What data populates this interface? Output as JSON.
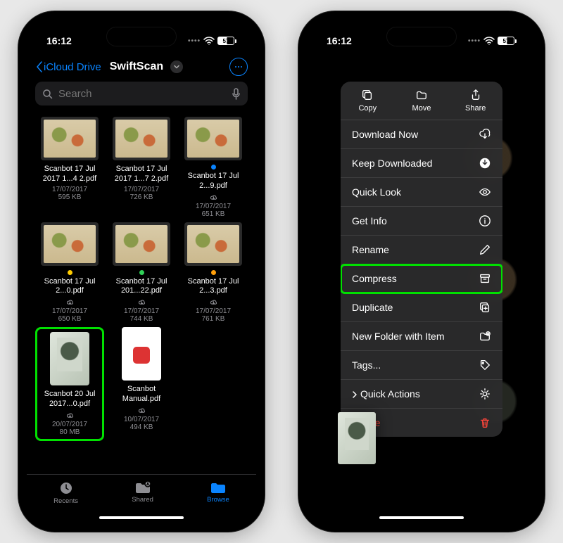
{
  "status": {
    "time": "16:12",
    "battery": "57"
  },
  "nav": {
    "back_label": "iCloud Drive",
    "title": "SwiftScan"
  },
  "search": {
    "placeholder": "Search"
  },
  "files": [
    {
      "name": "Scanbot 17 Jul 2017 1...4 2.pdf",
      "date": "17/07/2017",
      "size": "595 KB",
      "tag": null,
      "cloud": false,
      "thumb": "food"
    },
    {
      "name": "Scanbot 17 Jul 2017 1...7 2.pdf",
      "date": "17/07/2017",
      "size": "726 KB",
      "tag": null,
      "cloud": false,
      "thumb": "food"
    },
    {
      "name": "Scanbot 17 Jul 2...9.pdf",
      "date": "17/07/2017",
      "size": "651 KB",
      "tag": "#0a84ff",
      "cloud": true,
      "thumb": "food"
    },
    {
      "name": "Scanbot 17 Jul 2...0.pdf",
      "date": "17/07/2017",
      "size": "650 KB",
      "tag": "#ffcc00",
      "cloud": true,
      "thumb": "food"
    },
    {
      "name": "Scanbot 17 Jul 201...22.pdf",
      "date": "17/07/2017",
      "size": "744 KB",
      "tag": "#30d158",
      "cloud": true,
      "thumb": "food"
    },
    {
      "name": "Scanbot 17 Jul 2...3.pdf",
      "date": "17/07/2017",
      "size": "761 KB",
      "tag": "#ff9f0a",
      "cloud": true,
      "thumb": "food"
    },
    {
      "name": "Scanbot 20 Jul 2017...0.pdf",
      "date": "20/07/2017",
      "size": "80 MB",
      "tag": null,
      "cloud": true,
      "thumb": "book",
      "highlight": true
    },
    {
      "name": "Scanbot Manual.pdf",
      "date": "10/07/2017",
      "size": "494 KB",
      "tag": null,
      "cloud": true,
      "thumb": "manual"
    }
  ],
  "tabs": {
    "recents": "Recents",
    "shared": "Shared",
    "browse": "Browse"
  },
  "menu": {
    "top": {
      "copy": "Copy",
      "move": "Move",
      "share": "Share"
    },
    "rows": {
      "download_now": "Download Now",
      "keep_downloaded": "Keep Downloaded",
      "quick_look": "Quick Look",
      "get_info": "Get Info",
      "rename": "Rename",
      "compress": "Compress",
      "duplicate": "Duplicate",
      "new_folder": "New Folder with Item",
      "tags": "Tags...",
      "quick_actions": "Quick Actions",
      "delete": "Delete"
    }
  }
}
